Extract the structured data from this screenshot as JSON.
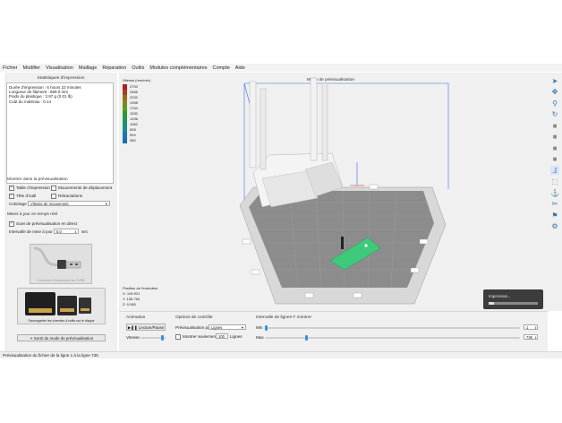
{
  "menu": [
    "Fichier",
    "Modifier",
    "Visualisation",
    "Maillage",
    "Réparation",
    "Outils",
    "Modules complémentaires",
    "Compte",
    "Aide"
  ],
  "stats": {
    "title": "Statistiques d'impression",
    "lines": [
      "Durée d'impression : 6 hours 22 minutes",
      "Longueur de filament : 869.0 mm",
      "Poids du plastique : 2.97 g (0.01 lb)",
      "Coût du matériau : 0.14"
    ]
  },
  "preview_options": {
    "title": "Montrer dans la prévisualisation",
    "table_impression": "Table d'impression",
    "mouvements_deplacement": "Mouvements de déplacement",
    "tete_outil": "Tête d'outil",
    "retractations": "Rétractations",
    "coloriage_label": "Coloriage",
    "coloriage_value": "Vitesse de mouvement"
  },
  "realtime": {
    "title": "Mises à jour en temps réel",
    "suivi_label": "Suivi de prévisualisation en direct",
    "intervalle_label": "Intervalle de mise à jour",
    "intervalle_value": "5,0",
    "intervalle_unit": "sec"
  },
  "usb": {
    "label": "Connexion l'impression sur l'USB"
  },
  "sd": {
    "label": "Sauvegarder les chemins d'outils sur le disque"
  },
  "exit_preview": {
    "label": "Sortir du mode de prévisualisation"
  },
  "viewport": {
    "title": "Mode de prévisualisation",
    "legend_title": "Vitesse (mm/min)",
    "legend_values": [
      "2700",
      "2466",
      "2232",
      "1998",
      "1764",
      "1530",
      "1296",
      "1062",
      "828",
      "594",
      "360"
    ],
    "legend_colors": [
      "#b21f1f",
      "#a8411e",
      "#9a6a1e",
      "#7f8a1e",
      "#5b9a22",
      "#2f9a30",
      "#1f9856",
      "#1e9278",
      "#1c8896",
      "#1b7aa8",
      "#1a6fb4"
    ],
    "extruder_title": "Position de l'extrudeur",
    "extruder_x": "X: 105.921",
    "extruder_y": "Y: 156.754",
    "extruder_z": "Z: 9.285"
  },
  "progress": {
    "label": "Impression...",
    "fraction": 0.1
  },
  "animation": {
    "title": "Animation",
    "play_label": "Lecture/Pause",
    "speed_label": "Vitesse",
    "speed_fraction": 0.9
  },
  "controls": {
    "title": "Options de contrôle",
    "preview_by_label": "Prévisualisation par",
    "preview_by_value": "Lignes",
    "show_only_label": "Montrer seulement",
    "show_only_value": "100",
    "show_only_unit": "Lignes"
  },
  "range": {
    "title": "Intervalle de lignes F montrer",
    "min_label": "Min",
    "min_value": "1",
    "min_fraction": 0.0,
    "max_label": "Max",
    "max_value": "736",
    "max_fraction": 0.16
  },
  "status": {
    "text": "Prévisualisation du fichier de la ligne 1 à la ligne 736"
  },
  "toolbar_icons": [
    "arrow-cursor-icon",
    "move-icon",
    "zoom-icon",
    "rotate-icon",
    "cube-front-icon",
    "cube-top-icon",
    "cube-side-icon",
    "cube-iso-icon",
    "axes-icon",
    "cube-perspective-icon",
    "anchor-icon",
    "cut-icon",
    "support-icon",
    "settings-gear-icon"
  ]
}
